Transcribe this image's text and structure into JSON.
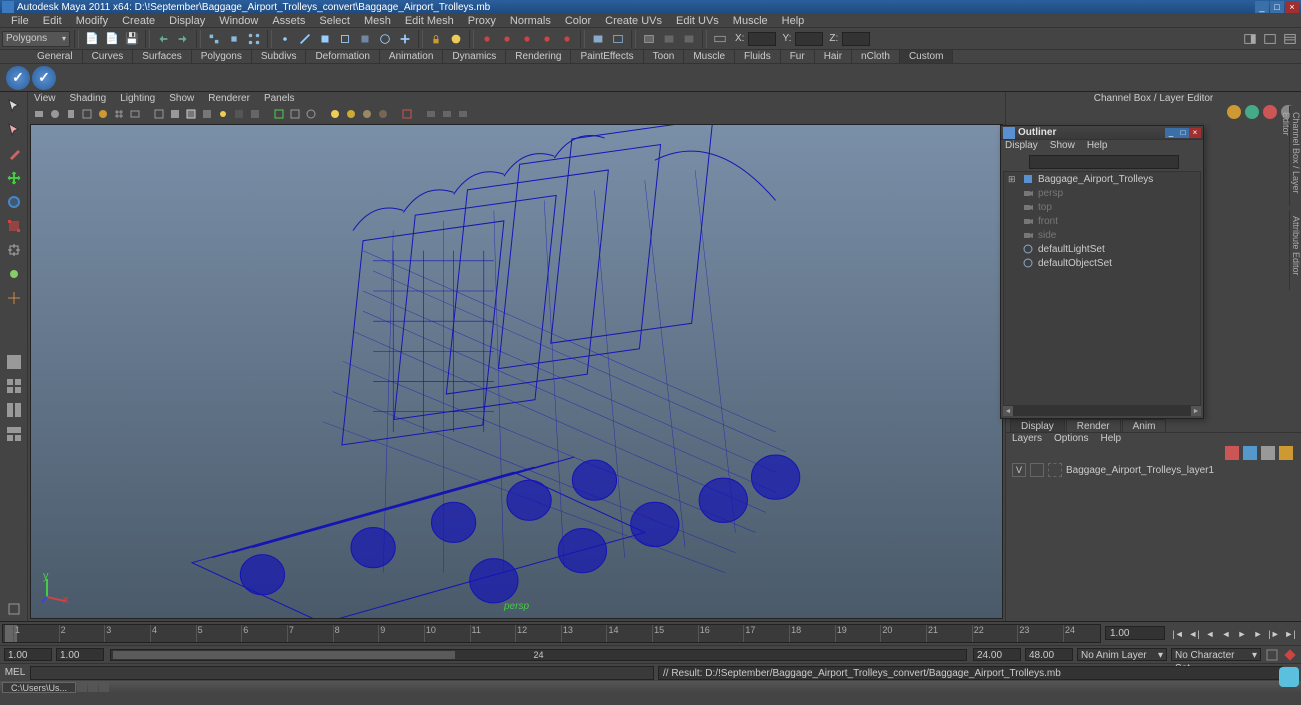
{
  "title": "Autodesk Maya 2011 x64: D:\\!September\\Baggage_Airport_Trolleys_convert\\Baggage_Airport_Trolleys.mb",
  "menubar": [
    "File",
    "Edit",
    "Modify",
    "Create",
    "Display",
    "Window",
    "Assets",
    "Select",
    "Mesh",
    "Edit Mesh",
    "Proxy",
    "Normals",
    "Color",
    "Create UVs",
    "Edit UVs",
    "Muscle",
    "Help"
  ],
  "main_toolbar": {
    "mode": "Polygons",
    "fields": {
      "x": "X:",
      "y": "Y:",
      "z": "Z:"
    }
  },
  "shelf_tabs": [
    "General",
    "Curves",
    "Surfaces",
    "Polygons",
    "Subdivs",
    "Deformation",
    "Animation",
    "Dynamics",
    "Rendering",
    "PaintEffects",
    "Toon",
    "Muscle",
    "Fluids",
    "Fur",
    "Hair",
    "nCloth",
    "Custom"
  ],
  "viewport_menus": [
    "View",
    "Shading",
    "Lighting",
    "Show",
    "Renderer",
    "Panels"
  ],
  "persp_label": "persp",
  "right_panel": {
    "title": "Channel Box / Layer Editor"
  },
  "display_tabs": [
    "Display",
    "Render",
    "Anim"
  ],
  "display_menus": [
    "Layers",
    "Options",
    "Help"
  ],
  "layer": {
    "vis": "V",
    "name": "Baggage_Airport_Trolleys_layer1"
  },
  "outliner": {
    "title": "Outliner",
    "menus": [
      "Display",
      "Show",
      "Help"
    ],
    "items": [
      {
        "label": "Baggage_Airport_Trolleys",
        "dim": false,
        "exp": true
      },
      {
        "label": "persp",
        "dim": true
      },
      {
        "label": "top",
        "dim": true
      },
      {
        "label": "front",
        "dim": true
      },
      {
        "label": "side",
        "dim": true
      },
      {
        "label": "defaultLightSet",
        "dim": false
      },
      {
        "label": "defaultObjectSet",
        "dim": false
      }
    ]
  },
  "timeline_end": "1.00",
  "range": {
    "start": "1.00",
    "end": "1.00",
    "playback_end": "24.00",
    "anim_end": "48.00",
    "cur": "24"
  },
  "anim_layer": "No Anim Layer",
  "char_set": "No Character Set",
  "cmd_label": "MEL",
  "status": "// Result: D:/!September/Baggage_Airport_Trolleys_convert/Baggage_Airport_Trolleys.mb",
  "task": "C:\\Users\\Us...",
  "vert_tabs": {
    "t1": "Channel Box / Layer Editor",
    "t2": "Attribute Editor"
  }
}
